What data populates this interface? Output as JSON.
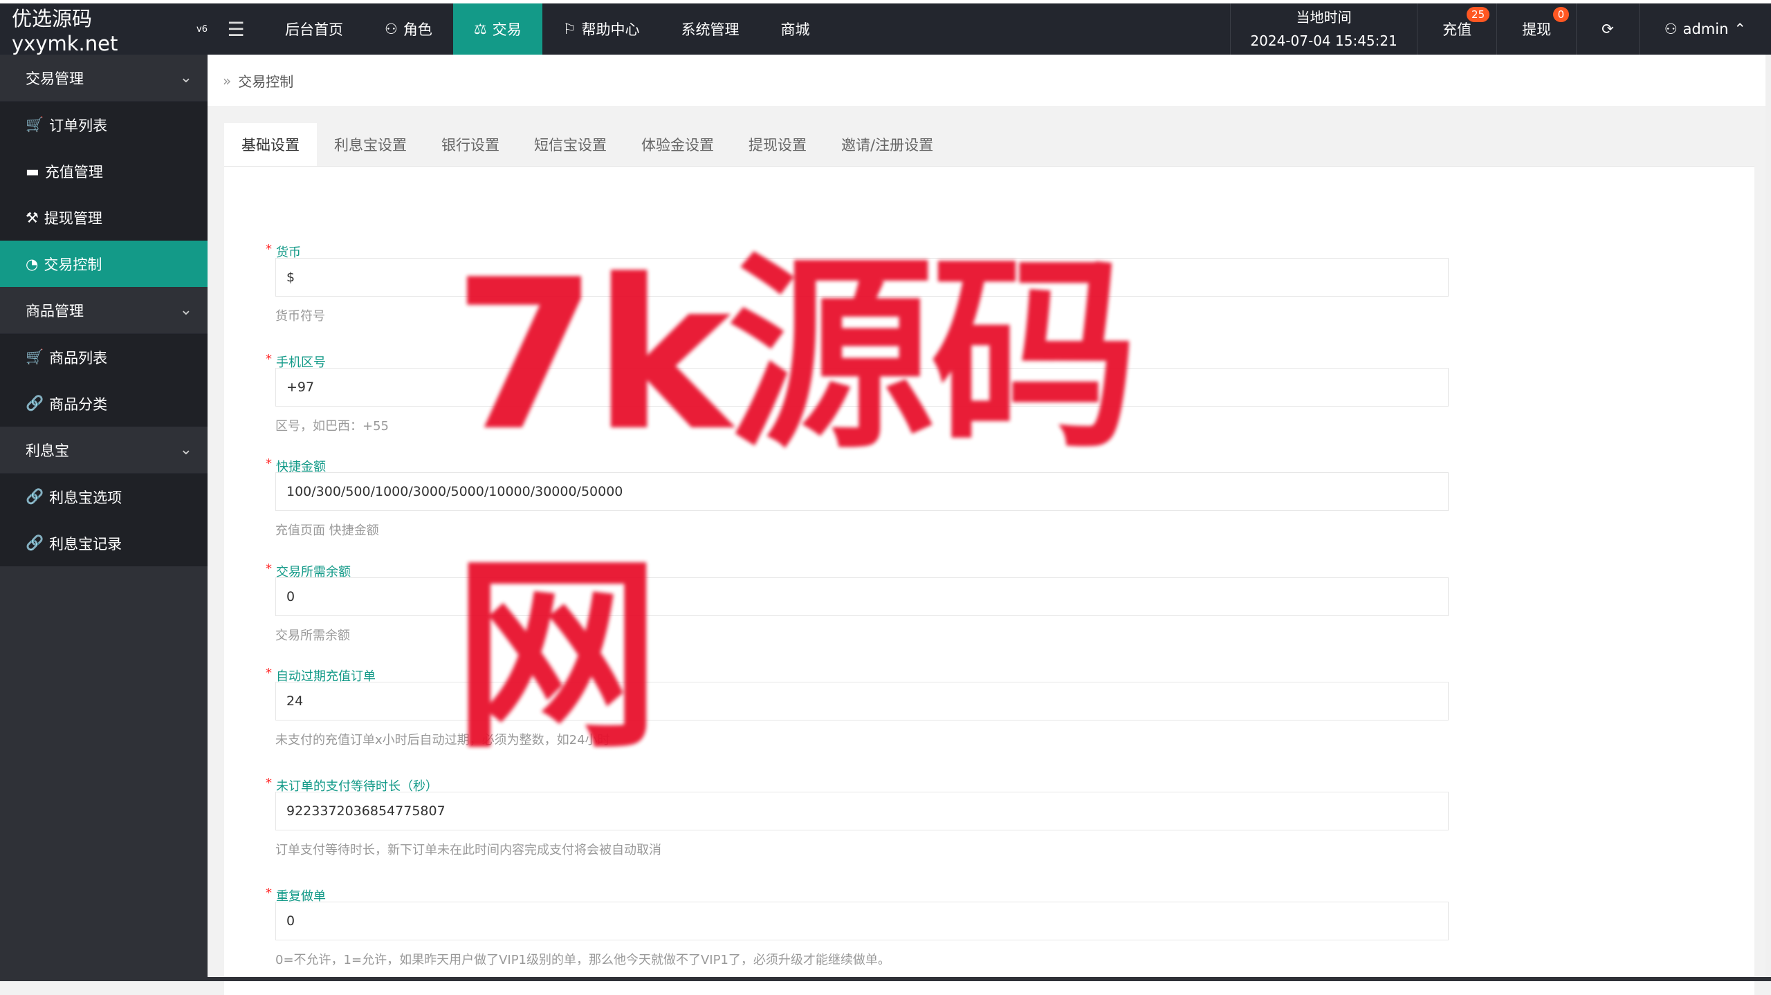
{
  "header": {
    "logo": "优选源码yxymk.net",
    "logo_sup": "v6",
    "nav": [
      "后台首页",
      "角色",
      "交易",
      "帮助中心",
      "系统管理",
      "商城"
    ],
    "time_label": "当地时间",
    "time_value": "2024-07-04 15:45:21",
    "recharge_label": "充值",
    "recharge_badge": "25",
    "withdraw_label": "提现",
    "withdraw_badge": "0",
    "user": "admin"
  },
  "sidebar": {
    "group1": "交易管理",
    "items1": [
      "订单列表",
      "充值管理",
      "提现管理",
      "交易控制"
    ],
    "group2": "商品管理",
    "items2": [
      "商品列表",
      "商品分类"
    ],
    "group3": "利息宝",
    "items3": [
      "利息宝选项",
      "利息宝记录"
    ]
  },
  "breadcrumb": "交易控制",
  "tabs": [
    "基础设置",
    "利息宝设置",
    "银行设置",
    "短信宝设置",
    "体验金设置",
    "提现设置",
    "邀请/注册设置"
  ],
  "fields": [
    {
      "label": "货币",
      "value": "$",
      "hint": "货币符号"
    },
    {
      "label": "手机区号",
      "value": "+97",
      "hint": "区号，如巴西：+55"
    },
    {
      "label": "快捷金额",
      "value": "100/300/500/1000/3000/5000/10000/30000/50000",
      "hint": "充值页面 快捷金额"
    },
    {
      "label": "交易所需余额",
      "value": "0",
      "hint": "交易所需余额"
    },
    {
      "label": "自动过期充值订单",
      "value": "24",
      "hint": "未支付的充值订单x小时后自动过期，必须为整数，如24小时"
    },
    {
      "label": "未订单的支付等待时长（秒）",
      "value": "9223372036854775807",
      "hint": "订单支付等待时长，新下订单未在此时间内容完成支付将会被自动取消"
    },
    {
      "label": "重复做单",
      "value": "0",
      "hint": "0=不允许，1=允许，如果昨天用户做了VIP1级别的单，那么他今天就做不了VIP1了，必须升级才能继续做单。"
    }
  ],
  "watermark": "7k源码网",
  "colors": {
    "accent": "#139a88",
    "topbar": "#23262e",
    "sidebar": "#2f3137",
    "badge": "#ff5722",
    "watermark": "#e8112d"
  }
}
